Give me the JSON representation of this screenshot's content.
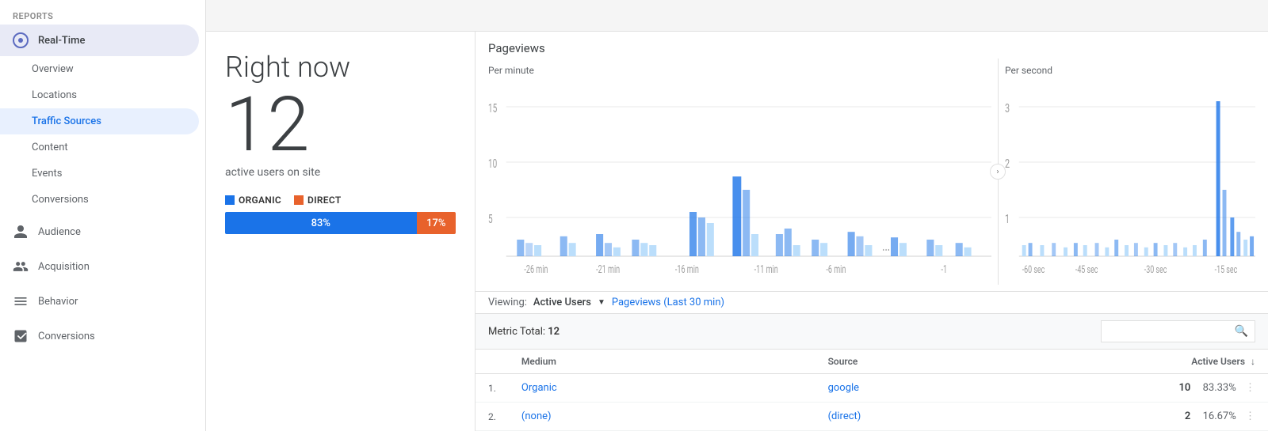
{
  "sidebar": {
    "reports_label": "REPORTS",
    "realtime_label": "Real-Time",
    "sub_items": [
      {
        "label": "Overview",
        "active": false
      },
      {
        "label": "Locations",
        "active": false
      },
      {
        "label": "Traffic Sources",
        "active": true
      },
      {
        "label": "Content",
        "active": false
      },
      {
        "label": "Events",
        "active": false
      },
      {
        "label": "Conversions",
        "active": false
      }
    ],
    "sections": [
      {
        "label": "Audience",
        "icon": "person"
      },
      {
        "label": "Acquisition",
        "icon": "acquisition"
      },
      {
        "label": "Behavior",
        "icon": "behavior"
      },
      {
        "label": "Conversions",
        "icon": "conversions"
      }
    ]
  },
  "main": {
    "right_now_label": "Right now",
    "active_count": "12",
    "active_users_label": "active users on site",
    "pageviews_label": "Pageviews",
    "per_minute_label": "Per minute",
    "per_second_label": "Per second",
    "expand_icon": "›",
    "legend": [
      {
        "label": "ORGANIC",
        "class": "organic"
      },
      {
        "label": "DIRECT",
        "class": "direct"
      }
    ],
    "organic_pct": "83%",
    "direct_pct": "17%",
    "organic_width": 83,
    "direct_width": 17,
    "viewing_label": "Viewing:",
    "active_users_tab": "Active Users",
    "pageviews_tab": "Pageviews (Last 30 min)",
    "metric_total_label": "Metric Total:",
    "metric_total_value": "12",
    "table_headers": [
      {
        "label": "Medium"
      },
      {
        "label": "Source"
      },
      {
        "label": "Active Users",
        "sortable": true
      }
    ],
    "table_rows": [
      {
        "num": "1.",
        "medium": "Organic",
        "source": "google",
        "active_users": "10",
        "pct": "83.33%"
      },
      {
        "num": "2.",
        "medium": "(none)",
        "source": "(direct)",
        "active_users": "2",
        "pct": "16.67%"
      }
    ],
    "per_minute_y_labels": [
      "15",
      "10",
      "5"
    ],
    "per_minute_x_labels": [
      "-26 min",
      "-21 min",
      "-16 min",
      "-11 min",
      "-6 min",
      "-1"
    ],
    "per_second_y_labels": [
      "3",
      "2",
      "1"
    ],
    "per_second_x_labels": [
      "-60 sec",
      "-45 sec",
      "-30 sec",
      "-15 sec"
    ]
  }
}
